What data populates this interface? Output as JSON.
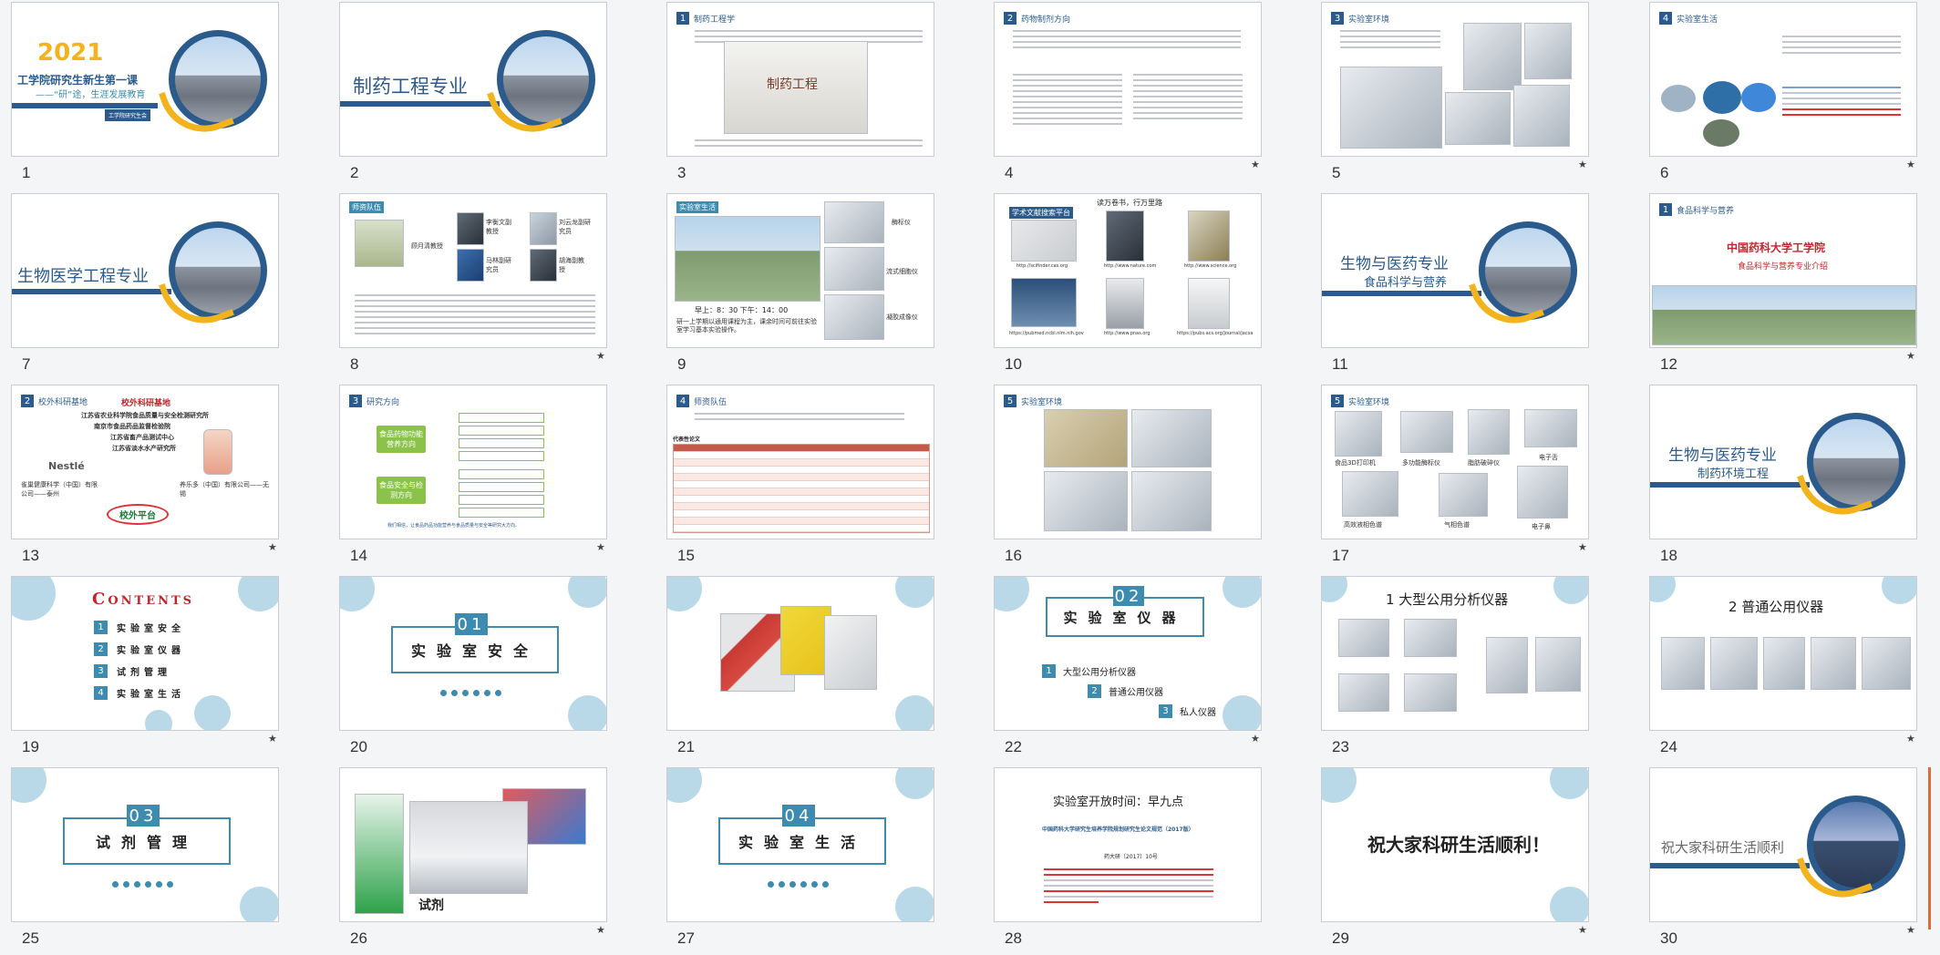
{
  "slide_numbers": [
    "1",
    "2",
    "3",
    "4",
    "5",
    "6",
    "7",
    "8",
    "9",
    "10",
    "11",
    "12",
    "13",
    "14",
    "15",
    "16",
    "17",
    "18",
    "19",
    "20",
    "21",
    "22",
    "23",
    "24",
    "25",
    "26",
    "27",
    "28",
    "29",
    "30"
  ],
  "slides": {
    "s1": {
      "year": "2021",
      "title": "工学院研究生新生第一课",
      "subtitle": "——“研”途，生涯发展教育",
      "tag": "工学院研究生会"
    },
    "s2": {
      "title": "制药工程专业"
    },
    "s3": {
      "header": "制药工程学",
      "sign": "制药工程"
    },
    "s4": {
      "header": "药物制剂方向"
    },
    "s5": {
      "header": "实验室环境"
    },
    "s6": {
      "header": "实验室生活"
    },
    "s7": {
      "title": "生物医学工程专业"
    },
    "s8": {
      "header": "师资队伍",
      "people": [
        "顾月清教授",
        "李衡文副教授",
        "刘云龙副研究员",
        "马林副研究员",
        "胡海副教授"
      ]
    },
    "s9": {
      "header": "实验室生活",
      "hours": "早上：8：30  下午：14：00",
      "note": "研一上学期以通用课程为主，课余时间可前往实验室学习基本实验操作。",
      "instruments": [
        "酶标仪",
        "流式细胞仪",
        "凝胶成像仪"
      ]
    },
    "s10": {
      "title": "学术文献搜索平台",
      "motto": "读万卷书，行万里路",
      "links": [
        "http://scifinder.cas.org",
        "http://www.nature.com",
        "http://www.science.org",
        "https://pubmed.ncbi.nlm.nih.gov",
        "http://www.pnas.org",
        "https://pubs.acs.org/journal/jacsa"
      ]
    },
    "s11": {
      "title": "生物与医药专业",
      "subtitle": "食品科学与营养"
    },
    "s12": {
      "header": "食品科学与营养",
      "school": "中国药科大学工学院",
      "major": "食品科学与营养专业介绍"
    },
    "s13": {
      "header": "校外科研基地",
      "heading": "校外科研基地",
      "bases": [
        "江苏省农业科学院食品质量与安全检测研究所",
        "南京市食品药品监督检验院",
        "江苏省畜产品测试中心",
        "江苏省淡水水产研究所"
      ],
      "left_company": "雀巢健康科学（中国）有限公司——泰州",
      "right_company": "养乐多（中国）有限公司——无锡",
      "platform": "校外平台",
      "nestle": "Nestlé"
    },
    "s14": {
      "header": "研究方向",
      "dir1": "食品药物功能营养方向",
      "dir2": "食品安全与检测方向",
      "note": "我们相信，让食品药品功能营养与食品质量与安全等研究大方向。"
    },
    "s15": {
      "header": "师资队伍",
      "table_title": "代表性论文"
    },
    "s16": {
      "header": "实验室环境"
    },
    "s17": {
      "header": "实验室环境",
      "instruments": [
        "食品3D打印机",
        "多功能酶标仪",
        "脂肪破碎仪",
        "电子舌",
        "高效液相色谱",
        "气相色谱",
        "电子鼻"
      ]
    },
    "s18": {
      "title": "生物与医药专业",
      "subtitle": "制药环境工程"
    },
    "s19": {
      "title": "Contents",
      "items": [
        "实验室安全",
        "实验室仪器",
        "试剂管理",
        "实验室生活"
      ],
      "nums": [
        "1",
        "2",
        "3",
        "4"
      ]
    },
    "s20": {
      "num": "01",
      "title": "实验室安全"
    },
    "s22": {
      "num": "02",
      "title": "实验室仪器",
      "items": [
        "大型公用分析仪器",
        "普通公用仪器",
        "私人仪器"
      ],
      "nums": [
        "1",
        "2",
        "3"
      ]
    },
    "s23": {
      "title": "1  大型公用分析仪器"
    },
    "s24": {
      "title": "2  普通公用仪器"
    },
    "s25": {
      "num": "03",
      "title": "试剂管理"
    },
    "s26": {
      "caption": "试剂"
    },
    "s27": {
      "num": "04",
      "title": "实验室生活"
    },
    "s28": {
      "title": "实验室开放时间：早九点",
      "doc": "中国药科大学研究生培养学院规划研究生论文规范（2017版）",
      "date": "药大研〔2017〕10号"
    },
    "s29": {
      "title": "祝大家科研生活顺利！"
    },
    "s30": {
      "title": "祝大家科研生活顺利"
    }
  },
  "colors": {
    "primary": "#2b5b8c",
    "accent": "#f2b31c",
    "section": "#3d8cb0",
    "deco": "#b9d9e8",
    "highlight_scroll": "#e06a3a"
  }
}
